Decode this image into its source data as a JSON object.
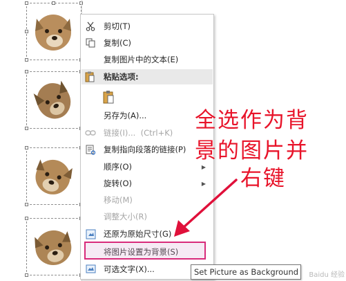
{
  "menu": {
    "cut": {
      "label": "剪切(T)",
      "icon": "scissors-icon"
    },
    "copy": {
      "label": "复制(C)",
      "icon": "copy-icon"
    },
    "copy_text": {
      "label": "复制图片中的文本(E)"
    },
    "paste_options_header": {
      "label": "粘贴选项:",
      "icon": "clipboard-icon"
    },
    "paste_option": {
      "icon": "paste-picture-icon"
    },
    "save_as": {
      "label": "另存为(A)..."
    },
    "link": {
      "label": "链接(I)...",
      "shortcut": "(Ctrl+K)",
      "icon": "link-icon",
      "disabled": true
    },
    "copy_link_paragraph": {
      "label": "复制指向段落的链接(P)",
      "icon": "paragraph-link-icon"
    },
    "order": {
      "label": "顺序(O)",
      "submenu": true
    },
    "rotate": {
      "label": "旋转(O)",
      "submenu": true
    },
    "move": {
      "label": "移动(M)",
      "disabled": true
    },
    "resize": {
      "label": "调整大小(R)",
      "disabled": true
    },
    "reset_size": {
      "label": "还原为原始尺寸(G)",
      "icon": "reset-size-icon"
    },
    "set_background": {
      "label": "将图片设置为背景(S)",
      "highlighted": true
    },
    "alt_text": {
      "label": "可选文字(X)...",
      "icon": "alt-text-icon"
    }
  },
  "tooltip": {
    "text": "Set Picture as Background"
  },
  "annotation": {
    "lines": [
      "全选作为背",
      "景的图片并",
      "右键"
    ],
    "color": "#e8142a"
  },
  "watermark": {
    "text": "Baidu 经验"
  },
  "colors": {
    "highlight_border": "#d82a7a",
    "menu_section_bg": "#e9e9e9",
    "disabled_text": "#a6a6a6"
  }
}
